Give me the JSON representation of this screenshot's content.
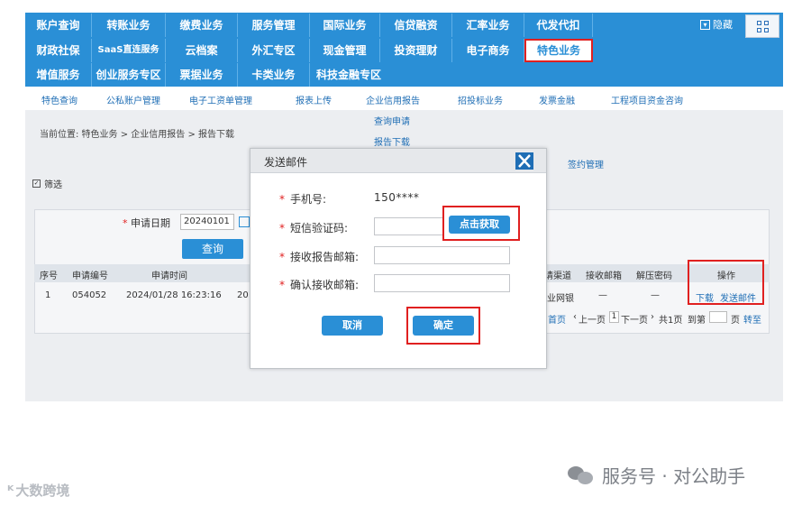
{
  "nav": {
    "row1": [
      "账户查询",
      "转账业务",
      "缴费业务",
      "服务管理",
      "国际业务",
      "信贷融资",
      "汇率业务",
      "代发代扣"
    ],
    "row2": [
      "财政社保",
      "SaaS直连服务",
      "云档案",
      "外汇专区",
      "现金管理",
      "投资理财",
      "电子商务",
      "特色业务"
    ],
    "row3": [
      "增值服务",
      "创业服务专区",
      "票据业务",
      "卡类业务",
      "科技金融专区"
    ],
    "hide_label": "隐藏"
  },
  "submenu": [
    "特色查询",
    "公私账户管理",
    "电子工资单管理",
    "报表上传",
    "企业信用报告",
    "招投标业务",
    "发票金融",
    "工程项目资金咨询"
  ],
  "dropdown": [
    "查询申请",
    "报告下载"
  ],
  "breadcrumb": "当前位置:  特色业务  >  企业信用报告  >  报告下载",
  "sign_link": "签约管理",
  "filter_label": "筛选",
  "search": {
    "date_label": "申请日期",
    "date_value": "20240101",
    "query_button": "查询"
  },
  "table": {
    "headers": [
      "序号",
      "申请编号",
      "申请时间",
      "请渠道",
      "接收邮箱",
      "解压密码",
      "操作"
    ],
    "row": {
      "index": "1",
      "app_no": "054052",
      "app_time": "2024/01/28  16:23:16",
      "cut_col": "20",
      "channel": "业网银",
      "email": "—",
      "password": "—",
      "download": "下载",
      "send_mail": "发送邮件"
    }
  },
  "pager": {
    "first": "首页",
    "prev": "上一页",
    "page": "1",
    "next": "下一页",
    "total": "共1页",
    "goto_prefix": "到第",
    "goto_suffix": "页",
    "go": "转至"
  },
  "modal": {
    "title": "发送邮件",
    "phone_label": "手机号:",
    "phone_value": "150****",
    "sms_label": "短信验证码:",
    "get_code": "点击获取",
    "email_label": "接收报告邮箱:",
    "confirm_email_label": "确认接收邮箱:",
    "cancel": "取消",
    "confirm": "确定"
  },
  "watermark_left": "大数跨境",
  "watermark_right": "服务号 · 对公助手",
  "colors": {
    "primary": "#2a8fd6",
    "highlight": "#e02020",
    "panel": "#eceef1"
  }
}
